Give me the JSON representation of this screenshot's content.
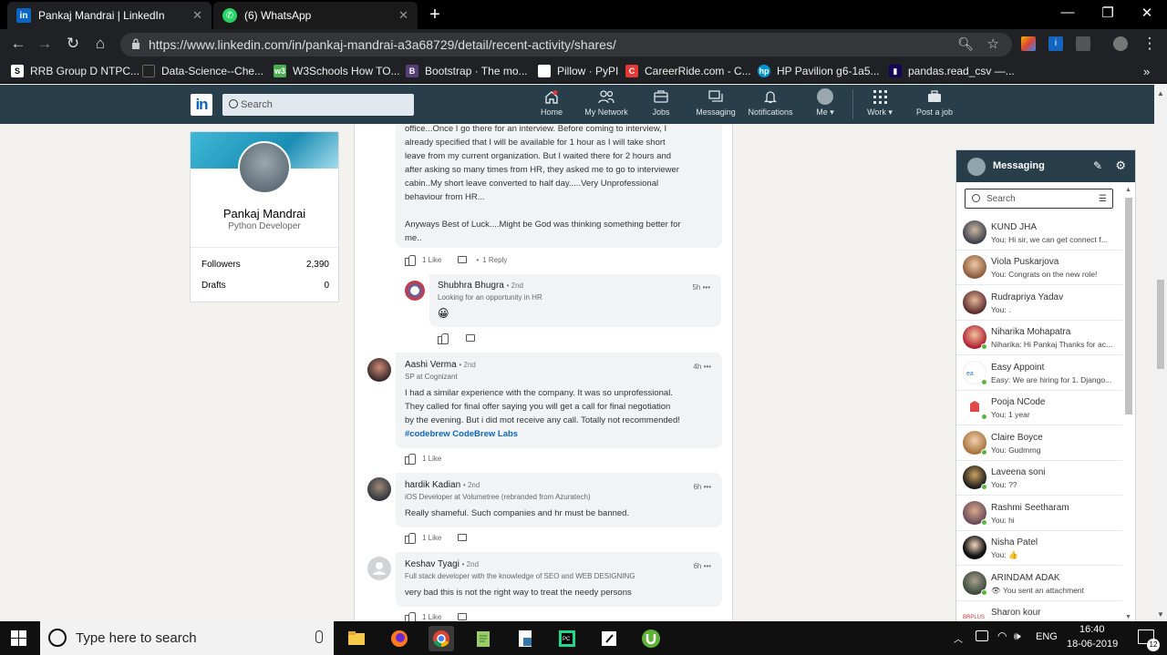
{
  "browser": {
    "tabs": [
      {
        "title": "Pankaj Mandrai | LinkedIn",
        "favicon": "in",
        "active": true
      },
      {
        "title": "(6) WhatsApp",
        "favicon": "whatsapp",
        "active": false
      }
    ],
    "url": "https://www.linkedin.com/in/pankaj-mandrai-a3a68729/detail/recent-activity/shares/",
    "bookmarks": [
      "RRB Group D NTPC...",
      "Data-Science--Che...",
      "W3Schools How TO...",
      "Bootstrap · The mo...",
      "Pillow · PyPI",
      "CareerRide.com - C...",
      "HP Pavilion g6-1a5...",
      "pandas.read_csv —..."
    ]
  },
  "linkedin": {
    "search_placeholder": "Search",
    "nav": {
      "home": "Home",
      "network": "My Network",
      "jobs": "Jobs",
      "messaging": "Messaging",
      "notifications": "Notifications",
      "me": "Me ▾",
      "work": "Work ▾",
      "post_job": "Post a job"
    }
  },
  "profile": {
    "name": "Pankaj Mandrai",
    "title": "Python Developer",
    "followers_label": "Followers",
    "followers_value": "2,390",
    "drafts_label": "Drafts",
    "drafts_value": "0"
  },
  "comments": {
    "first_partial": {
      "lines": [
        "office...Once I go there for an interview. Before coming to interview, I",
        "already specified that I will be available for 1 hour as I will take short",
        "leave from my current organization. But I waited there for 2 hours and",
        "after asking so many times from HR, they asked me to go to interviewer",
        "cabin..My short leave converted to half day.....Very Unprofessional",
        "behaviour from HR...",
        "",
        "Anyways Best of Luck....Might be God was thinking something better for",
        "me.."
      ],
      "likes": "1 Like",
      "replies": "1 Reply"
    },
    "reply": {
      "name": "Shubhra Bhugra",
      "degree": "• 2nd",
      "headline": "Looking for an opportunity in HR",
      "time": "5h",
      "emoji": "😀"
    },
    "aashi": {
      "name": "Aashi Verma",
      "degree": "• 2nd",
      "headline": "SP at Cognizant",
      "time": "4h",
      "lines": [
        "I had a similar experience with the company. It was so unprofessional.",
        "They called for final offer saying you will get a call for final negotiation",
        "by the evening. But i did mot receive any call. Totally not recommended!"
      ],
      "hashtag": "#codebrew",
      "company": "CodeBrew Labs",
      "likes": "1 Like"
    },
    "hardik": {
      "name": "hardik Kadian",
      "degree": "• 2nd",
      "headline": "iOS Developer at Volumetree (rebranded from Azuratech)",
      "time": "6h",
      "text": "Really shameful. Such companies and hr must be banned.",
      "likes": "1 Like"
    },
    "keshav": {
      "name": "Keshav Tyagi",
      "degree": "• 2nd",
      "headline": "Full stack developer with the knowledge of SEO and WEB DESIGNING",
      "time": "6h",
      "text": "very bad this is not the right way to treat the needy persons",
      "likes": "1 Like"
    }
  },
  "messaging": {
    "title": "Messaging",
    "search_placeholder": "Search",
    "conversations": [
      {
        "name": "KUND JHA",
        "preview": "You: Hi sir, we can get connect f..."
      },
      {
        "name": "Viola Puskarjova",
        "preview": "You: Congrats on the new role!"
      },
      {
        "name": "Rudrapriya Yadav",
        "preview": "You: ."
      },
      {
        "name": "Niharika Mohapatra",
        "preview": "Niharika: Hi Pankaj Thanks for ac..."
      },
      {
        "name": "Easy Appoint",
        "preview": "Easy: We are hiring for 1. Django..."
      },
      {
        "name": "Pooja NCode",
        "preview": "You: 1 year"
      },
      {
        "name": "Claire Boyce",
        "preview": "You: Gudmrng"
      },
      {
        "name": "Laveena soni",
        "preview": "You: ??"
      },
      {
        "name": "Rashmi Seetharam",
        "preview": "You: hi"
      },
      {
        "name": "Nisha Patel",
        "preview": "You: 👍"
      },
      {
        "name": "ARINDAM ADAK",
        "preview": "You sent an attachment"
      },
      {
        "name": "Sharon kour",
        "preview": ""
      }
    ]
  },
  "taskbar": {
    "search_text": "Type here to search",
    "language": "ENG",
    "time": "16:40",
    "date": "18-06-2019",
    "notifications": "12"
  }
}
